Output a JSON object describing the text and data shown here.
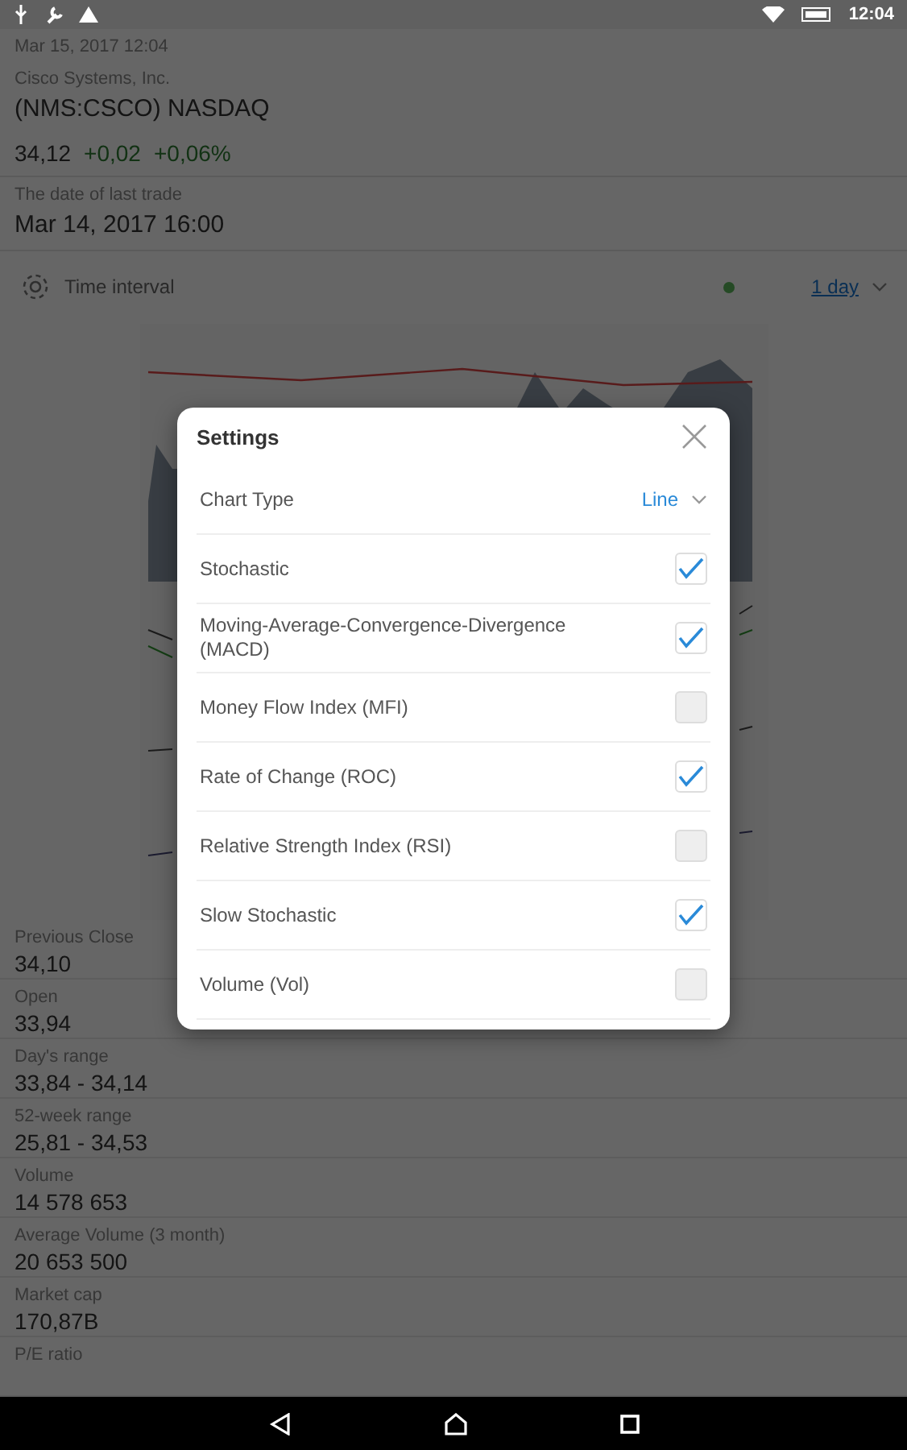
{
  "status_bar": {
    "time": "12:04"
  },
  "header": {
    "updated": "Mar 15, 2017 12:04",
    "company": "Cisco Systems, Inc.",
    "ticker": "(NMS:CSCO) NASDAQ",
    "price": "34,12",
    "change": "+0,02",
    "change_percent": "+0,06%",
    "last_trade_label": "The date of last trade",
    "last_trade": "Mar 14, 2017 16:00"
  },
  "time_interval": {
    "label": "Time interval",
    "value": "1 day"
  },
  "stats": [
    {
      "label": "Previous Close",
      "value": "34,10"
    },
    {
      "label": "Open",
      "value": "33,94"
    },
    {
      "label": "Day's range",
      "value": "33,84 - 34,14"
    },
    {
      "label": "52-week range",
      "value": "25,81 - 34,53"
    },
    {
      "label": "Volume",
      "value": "14 578 653"
    },
    {
      "label": "Average Volume (3 month)",
      "value": "20 653 500"
    },
    {
      "label": "Market cap",
      "value": "170,87B"
    },
    {
      "label": "P/E ratio"
    }
  ],
  "dialog": {
    "title": "Settings",
    "chart_type": {
      "label": "Chart Type",
      "value": "Line"
    },
    "indicators": [
      {
        "label": "Stochastic",
        "checked": true
      },
      {
        "label": "Moving-Average-Convergence-Divergence (MACD)",
        "checked": true
      },
      {
        "label": "Money Flow Index (MFI)",
        "checked": false
      },
      {
        "label": "Rate of Change (ROC)",
        "checked": true
      },
      {
        "label": "Relative Strength Index (RSI)",
        "checked": false
      },
      {
        "label": "Slow Stochastic",
        "checked": true
      },
      {
        "label": "Volume (Vol)",
        "checked": false
      }
    ]
  }
}
